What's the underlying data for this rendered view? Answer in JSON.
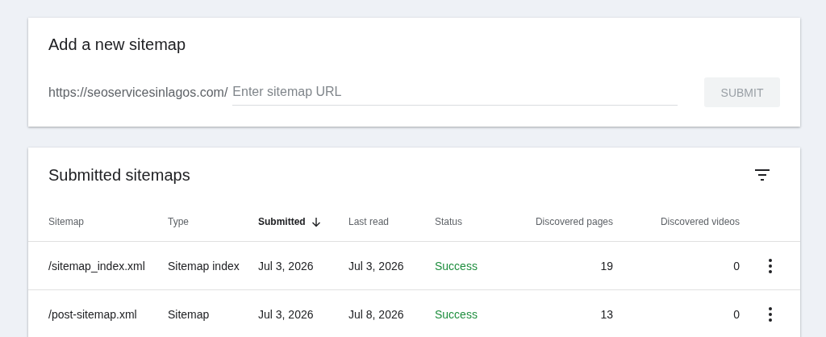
{
  "add_card": {
    "title": "Add a new sitemap",
    "url_prefix": "https://seoservicesinlagos.com/",
    "input": {
      "placeholder": "Enter sitemap URL"
    },
    "submit": {
      "label": "SUBMIT",
      "disabled": true
    }
  },
  "submitted_card": {
    "title": "Submitted sitemaps",
    "columns": [
      {
        "label": "Sitemap",
        "sorted": false
      },
      {
        "label": "Type",
        "sorted": false
      },
      {
        "label": "Submitted",
        "sorted": true
      },
      {
        "label": "Last read",
        "sorted": false
      },
      {
        "label": "Status",
        "sorted": false
      },
      {
        "label": "Discovered pages",
        "sorted": false
      },
      {
        "label": "Discovered videos",
        "sorted": false
      }
    ],
    "rows": [
      {
        "cells": [
          "/sitemap_index.xml",
          "Sitemap index",
          "Jul 3, 2026",
          "Jul 3, 2026",
          "Success",
          "19",
          "0"
        ],
        "success": true
      },
      {
        "cells": [
          "/post-sitemap.xml",
          "Sitemap",
          "Jul 3, 2026",
          "Jul 8, 2026",
          "Success",
          "13",
          "0"
        ],
        "success": true
      }
    ]
  }
}
